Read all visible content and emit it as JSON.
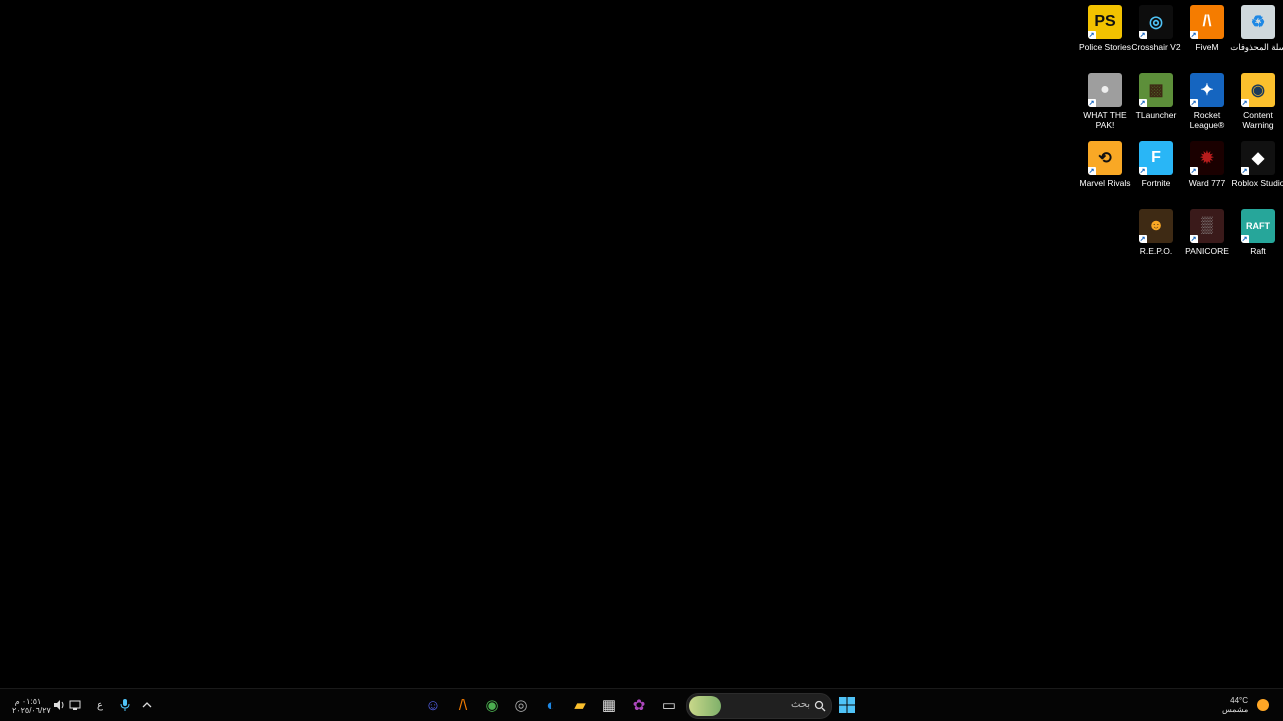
{
  "desktop_icons": [
    {
      "name": "police-stories",
      "label": "Police Stories",
      "glyph": "PS",
      "bg": "#f2c200",
      "fg": "#111"
    },
    {
      "name": "crosshair-v2",
      "label": "Crosshair V2",
      "glyph": "◎",
      "bg": "#0d0d0d",
      "fg": "#4fc3f7"
    },
    {
      "name": "fivem",
      "label": "FiveM",
      "glyph": "/\\",
      "bg": "#f57c00",
      "fg": "#fff"
    },
    {
      "name": "recycle-bin",
      "label": "سلة المحذوفات",
      "glyph": "♻",
      "bg": "#cfd8dc",
      "fg": "#1e88e5"
    },
    {
      "name": "what-the-pak",
      "label": "WHAT THE PAK!",
      "glyph": "●",
      "bg": "#9e9e9e",
      "fg": "#eee"
    },
    {
      "name": "tlauncher",
      "label": "TLauncher",
      "glyph": "▩",
      "bg": "#5d8f3a",
      "fg": "#3e2a14"
    },
    {
      "name": "rocket-league",
      "label": "Rocket League®",
      "glyph": "✦",
      "bg": "#1565c0",
      "fg": "#fff"
    },
    {
      "name": "content-warning",
      "label": "Content Warning",
      "glyph": "◉",
      "bg": "#fbc02d",
      "fg": "#1b3a5a"
    },
    {
      "name": "marvel-rivals",
      "label": "Marvel Rivals",
      "glyph": "⟲",
      "bg": "#f9a825",
      "fg": "#111"
    },
    {
      "name": "fortnite",
      "label": "Fortnite",
      "glyph": "F",
      "bg": "#29b6f6",
      "fg": "#fff"
    },
    {
      "name": "ward-777",
      "label": "Ward 777",
      "glyph": "✹",
      "bg": "#1a0000",
      "fg": "#b71c1c"
    },
    {
      "name": "roblox-studio",
      "label": "Roblox Studio",
      "glyph": "◆",
      "bg": "#111",
      "fg": "#fff"
    },
    {
      "name": "repo",
      "label": "R.E.P.O.",
      "glyph": "☻",
      "bg": "#3e2a14",
      "fg": "#f9a825"
    },
    {
      "name": "panicore",
      "label": "PANICORE",
      "glyph": "▒",
      "bg": "#3a1a1a",
      "fg": "#999"
    },
    {
      "name": "raft",
      "label": "Raft",
      "glyph": "RAFT",
      "bg": "#26a69a",
      "fg": "#fff"
    }
  ],
  "taskbar": {
    "search_placeholder": "بحث",
    "weather": {
      "temp": "44°C",
      "condition": "مشمس"
    },
    "clock": {
      "time": "٠١:٥١ م",
      "date": "٢٠٢٥/٠٦/٢٧"
    },
    "language": "ع",
    "apps": [
      {
        "name": "discord-icon",
        "glyph": "☺",
        "color": "#5865f2"
      },
      {
        "name": "fivem-taskbar-icon",
        "glyph": "/\\",
        "color": "#f57c00"
      },
      {
        "name": "chrome-icon",
        "glyph": "◉",
        "color": "#4caf50"
      },
      {
        "name": "crosshair-taskbar-icon",
        "glyph": "◎",
        "color": "#aaa"
      },
      {
        "name": "edge-icon",
        "glyph": "◐",
        "color": "#1e88e5"
      },
      {
        "name": "file-explorer-icon",
        "glyph": "▰",
        "color": "#fbc02d"
      },
      {
        "name": "store-icon",
        "glyph": "▦",
        "color": "#e0e0e0"
      },
      {
        "name": "copilot-icon",
        "glyph": "✿",
        "color": "#ab47bc"
      },
      {
        "name": "task-view-icon",
        "glyph": "▭",
        "color": "#ddd"
      }
    ]
  }
}
